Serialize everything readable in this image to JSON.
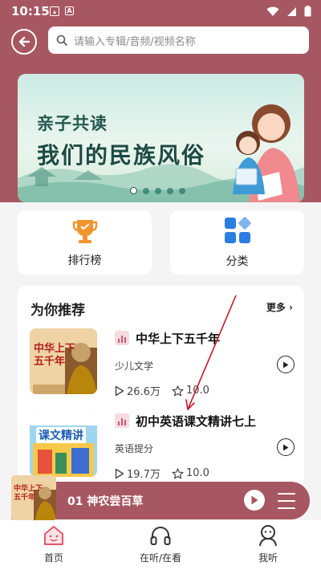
{
  "status": {
    "time": "10:15"
  },
  "search": {
    "placeholder": "请输入专辑/音频/视频名称"
  },
  "banner": {
    "line1": "亲子共读",
    "line2": "我们的民族风俗",
    "dots": 5,
    "active_dot": 0
  },
  "quick": [
    {
      "label": "排行榜",
      "icon": "trophy-icon"
    },
    {
      "label": "分类",
      "icon": "category-grid-icon"
    }
  ],
  "recommend": {
    "title": "为你推荐",
    "more": "更多",
    "items": [
      {
        "name": "中华上下五千年",
        "category": "少儿文学",
        "plays": "26.6万",
        "rating": "10.0",
        "cover_text": "中华上下\n五千年"
      },
      {
        "name": "初中英语课文精讲七上",
        "category": "英语提分",
        "plays": "19.7万",
        "rating": "10.0",
        "cover_text": "课文精讲"
      }
    ]
  },
  "player": {
    "track": "01 神农尝百草",
    "cover_text": "中华上下\n五千年"
  },
  "tabs": [
    {
      "label": "首页",
      "icon": "home-icon",
      "active": true
    },
    {
      "label": "在听/在看",
      "icon": "headphones-icon",
      "active": false
    },
    {
      "label": "我听",
      "icon": "profile-icon",
      "active": false
    }
  ],
  "colors": {
    "accent": "#a75761",
    "banner_text": "#1d4a43",
    "quick_icon_orange": "#f0942e",
    "quick_icon_blue": "#2b7de0"
  }
}
